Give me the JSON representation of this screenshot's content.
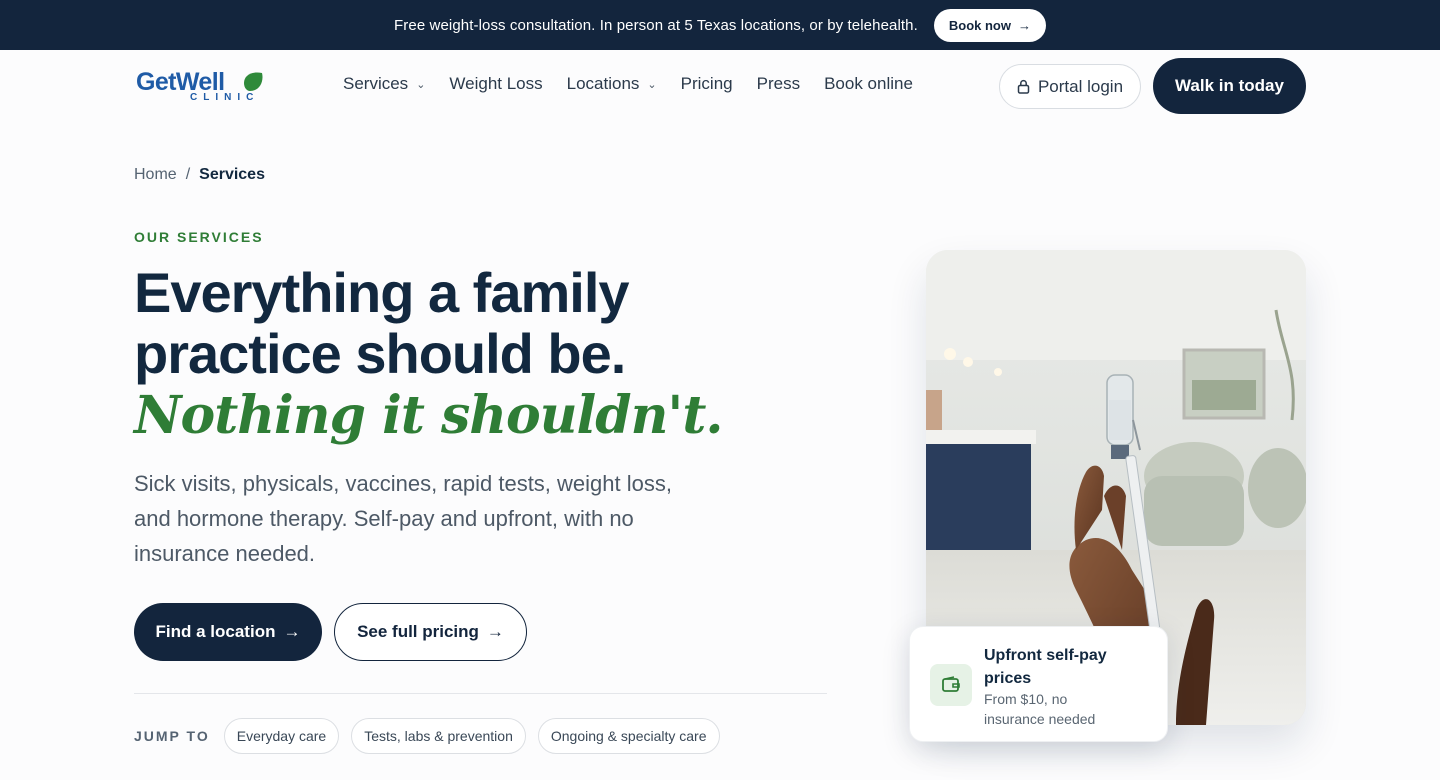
{
  "announcement": {
    "text": "Free weight-loss consultation. In person at 5 Texas locations, or by telehealth.",
    "cta_label": "Book now",
    "cta_arrow": "→"
  },
  "brand": {
    "name_part1": "GetWell",
    "subtitle": "CLINIC",
    "color_primary": "#1f5ba6",
    "color_accent": "#2f8a3a"
  },
  "nav": {
    "items": [
      {
        "label": "Services",
        "has_dropdown": true
      },
      {
        "label": "Weight Loss",
        "has_dropdown": false
      },
      {
        "label": "Locations",
        "has_dropdown": true
      },
      {
        "label": "Pricing",
        "has_dropdown": false
      },
      {
        "label": "Press",
        "has_dropdown": false
      },
      {
        "label": "Book online",
        "has_dropdown": false
      }
    ],
    "dropdown_glyph": "⌄",
    "portal_label": "Portal login",
    "walkin_label": "Walk in today"
  },
  "breadcrumb": {
    "home": "Home",
    "separator": "/",
    "current": "Services"
  },
  "hero": {
    "eyebrow": "OUR SERVICES",
    "headline_line1": "Everything a family",
    "headline_line2": "practice should be.",
    "headline_accent": "Nothing it shouldn't.",
    "lede": "Sick visits, physicals, vaccines, rapid tests, weight loss, and hormone therapy. Self-pay and upfront, with no insurance needed.",
    "primary_cta": "Find a location",
    "secondary_cta": "See full pricing",
    "arrow": "→"
  },
  "jump_to": {
    "label": "JUMP TO",
    "chips": [
      "Everyday care",
      "Tests, labs & prevention",
      "Ongoing & specialty care"
    ]
  },
  "price_card": {
    "title": "Upfront self-pay prices",
    "subtitle": "From $10, no insurance needed",
    "icon": "wallet-icon"
  },
  "colors": {
    "navy": "#13253d",
    "green": "#2f7d36"
  }
}
